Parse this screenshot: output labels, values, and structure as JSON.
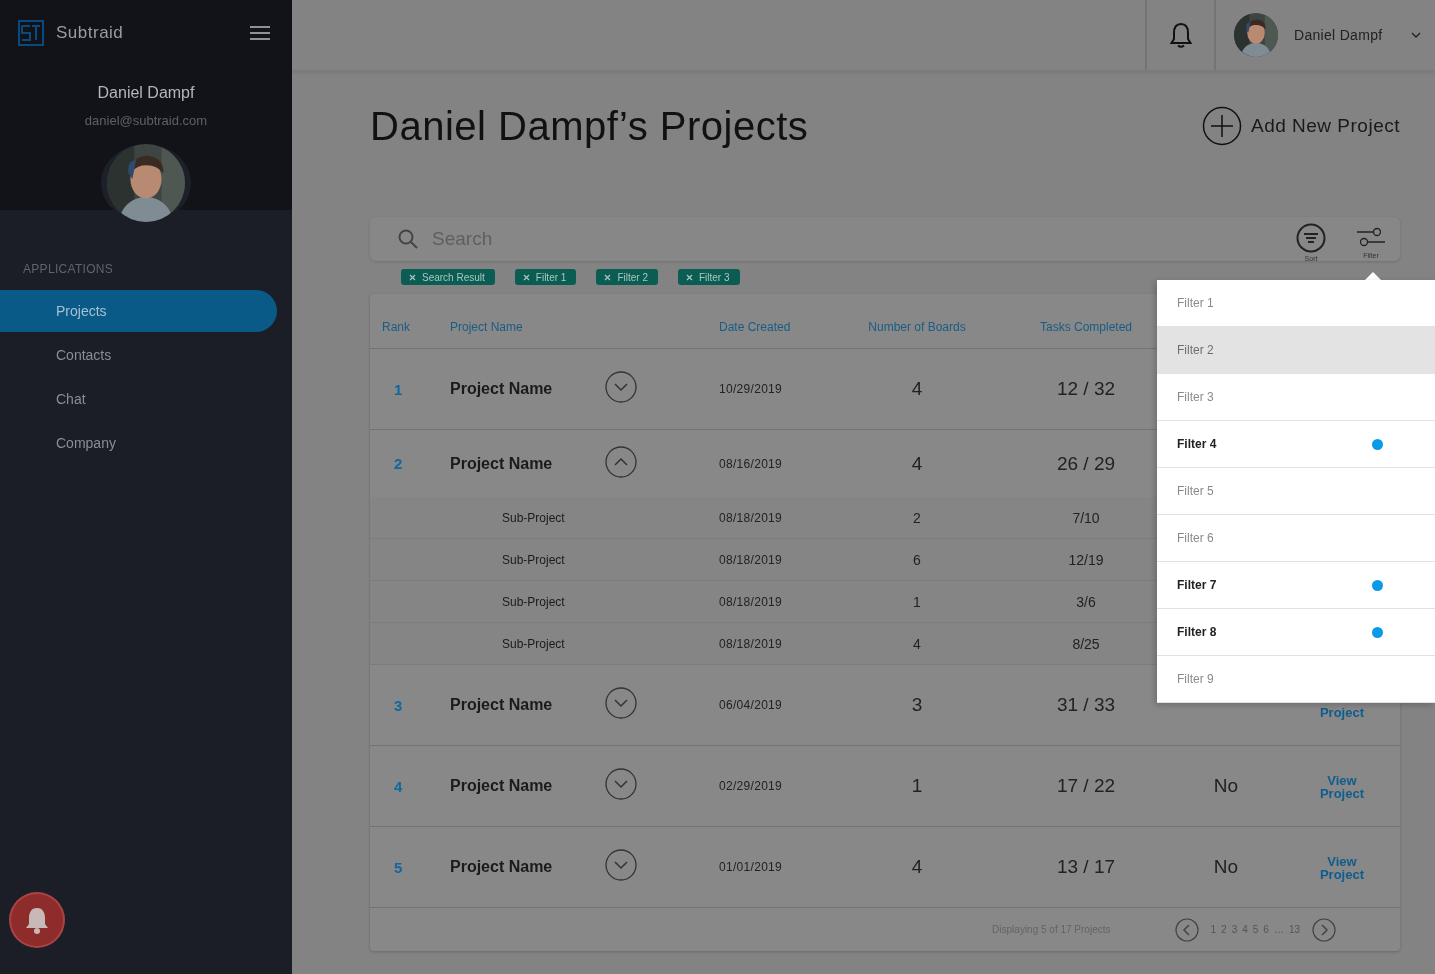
{
  "app": {
    "name": "Subtraid"
  },
  "user": {
    "name": "Daniel Dampf",
    "email": "daniel@subtraid.com"
  },
  "nav": {
    "section": "APPLICATIONS",
    "items": [
      {
        "label": "Projects",
        "selected": true
      },
      {
        "label": "Contacts",
        "selected": false
      },
      {
        "label": "Chat",
        "selected": false
      },
      {
        "label": "Company",
        "selected": false
      }
    ]
  },
  "topbar": {
    "user_name": "Daniel Dampf"
  },
  "page": {
    "title": "Daniel Dampf’s Projects",
    "add_button": "Add New Project"
  },
  "search": {
    "placeholder": "Search",
    "sort_label": "Sort",
    "filter_label": "Filter"
  },
  "chips": [
    "Search Result",
    "Filter 1",
    "Filter 2",
    "Filter 3"
  ],
  "table": {
    "columns": [
      "Rank",
      "Project Name",
      "Date Created",
      "Number of Boards",
      "Tasks Completed"
    ],
    "rows": [
      {
        "rank": "1",
        "name": "Project Name",
        "expanded": false,
        "date": "10/29/2019",
        "boards": "4",
        "tasks": "12 / 32"
      },
      {
        "rank": "2",
        "name": "Project Name",
        "expanded": true,
        "date": "08/16/2019",
        "boards": "4",
        "tasks": "26 / 29",
        "children": [
          {
            "name": "Sub-Project",
            "date": "08/18/2019",
            "boards": "2",
            "tasks": "7/10"
          },
          {
            "name": "Sub-Project",
            "date": "08/18/2019",
            "boards": "6",
            "tasks": "12/19"
          },
          {
            "name": "Sub-Project",
            "date": "08/18/2019",
            "boards": "1",
            "tasks": "3/6"
          },
          {
            "name": "Sub-Project",
            "date": "08/18/2019",
            "boards": "4",
            "tasks": "8/25"
          }
        ]
      },
      {
        "rank": "3",
        "name": "Project Name",
        "expanded": false,
        "date": "06/04/2019",
        "boards": "3",
        "tasks": "31 / 33",
        "link": "Project"
      },
      {
        "rank": "4",
        "name": "Project Name",
        "expanded": false,
        "date": "02/29/2019",
        "boards": "1",
        "tasks": "17 / 22",
        "status": "No",
        "link": "View Project"
      },
      {
        "rank": "5",
        "name": "Project Name",
        "expanded": false,
        "date": "01/01/2019",
        "boards": "4",
        "tasks": "13 / 17",
        "status": "No",
        "link": "View Project"
      }
    ]
  },
  "footer": {
    "summary": "Displaying 5 of 17 Projects",
    "pages": [
      "1",
      "2",
      "3",
      "4",
      "5",
      "6",
      "…",
      "13"
    ]
  },
  "filter_menu": {
    "items": [
      {
        "label": "Filter 1",
        "selected": false,
        "hovered": false
      },
      {
        "label": "Filter 2",
        "selected": false,
        "hovered": true
      },
      {
        "label": "Filter 3",
        "selected": false,
        "hovered": false
      },
      {
        "label": "Filter 4",
        "selected": true,
        "hovered": false
      },
      {
        "label": "Filter 5",
        "selected": false,
        "hovered": false
      },
      {
        "label": "Filter 6",
        "selected": false,
        "hovered": false
      },
      {
        "label": "Filter 7",
        "selected": true,
        "hovered": false
      },
      {
        "label": "Filter 8",
        "selected": true,
        "hovered": false
      },
      {
        "label": "Filter 9",
        "selected": false,
        "hovered": false
      }
    ]
  }
}
